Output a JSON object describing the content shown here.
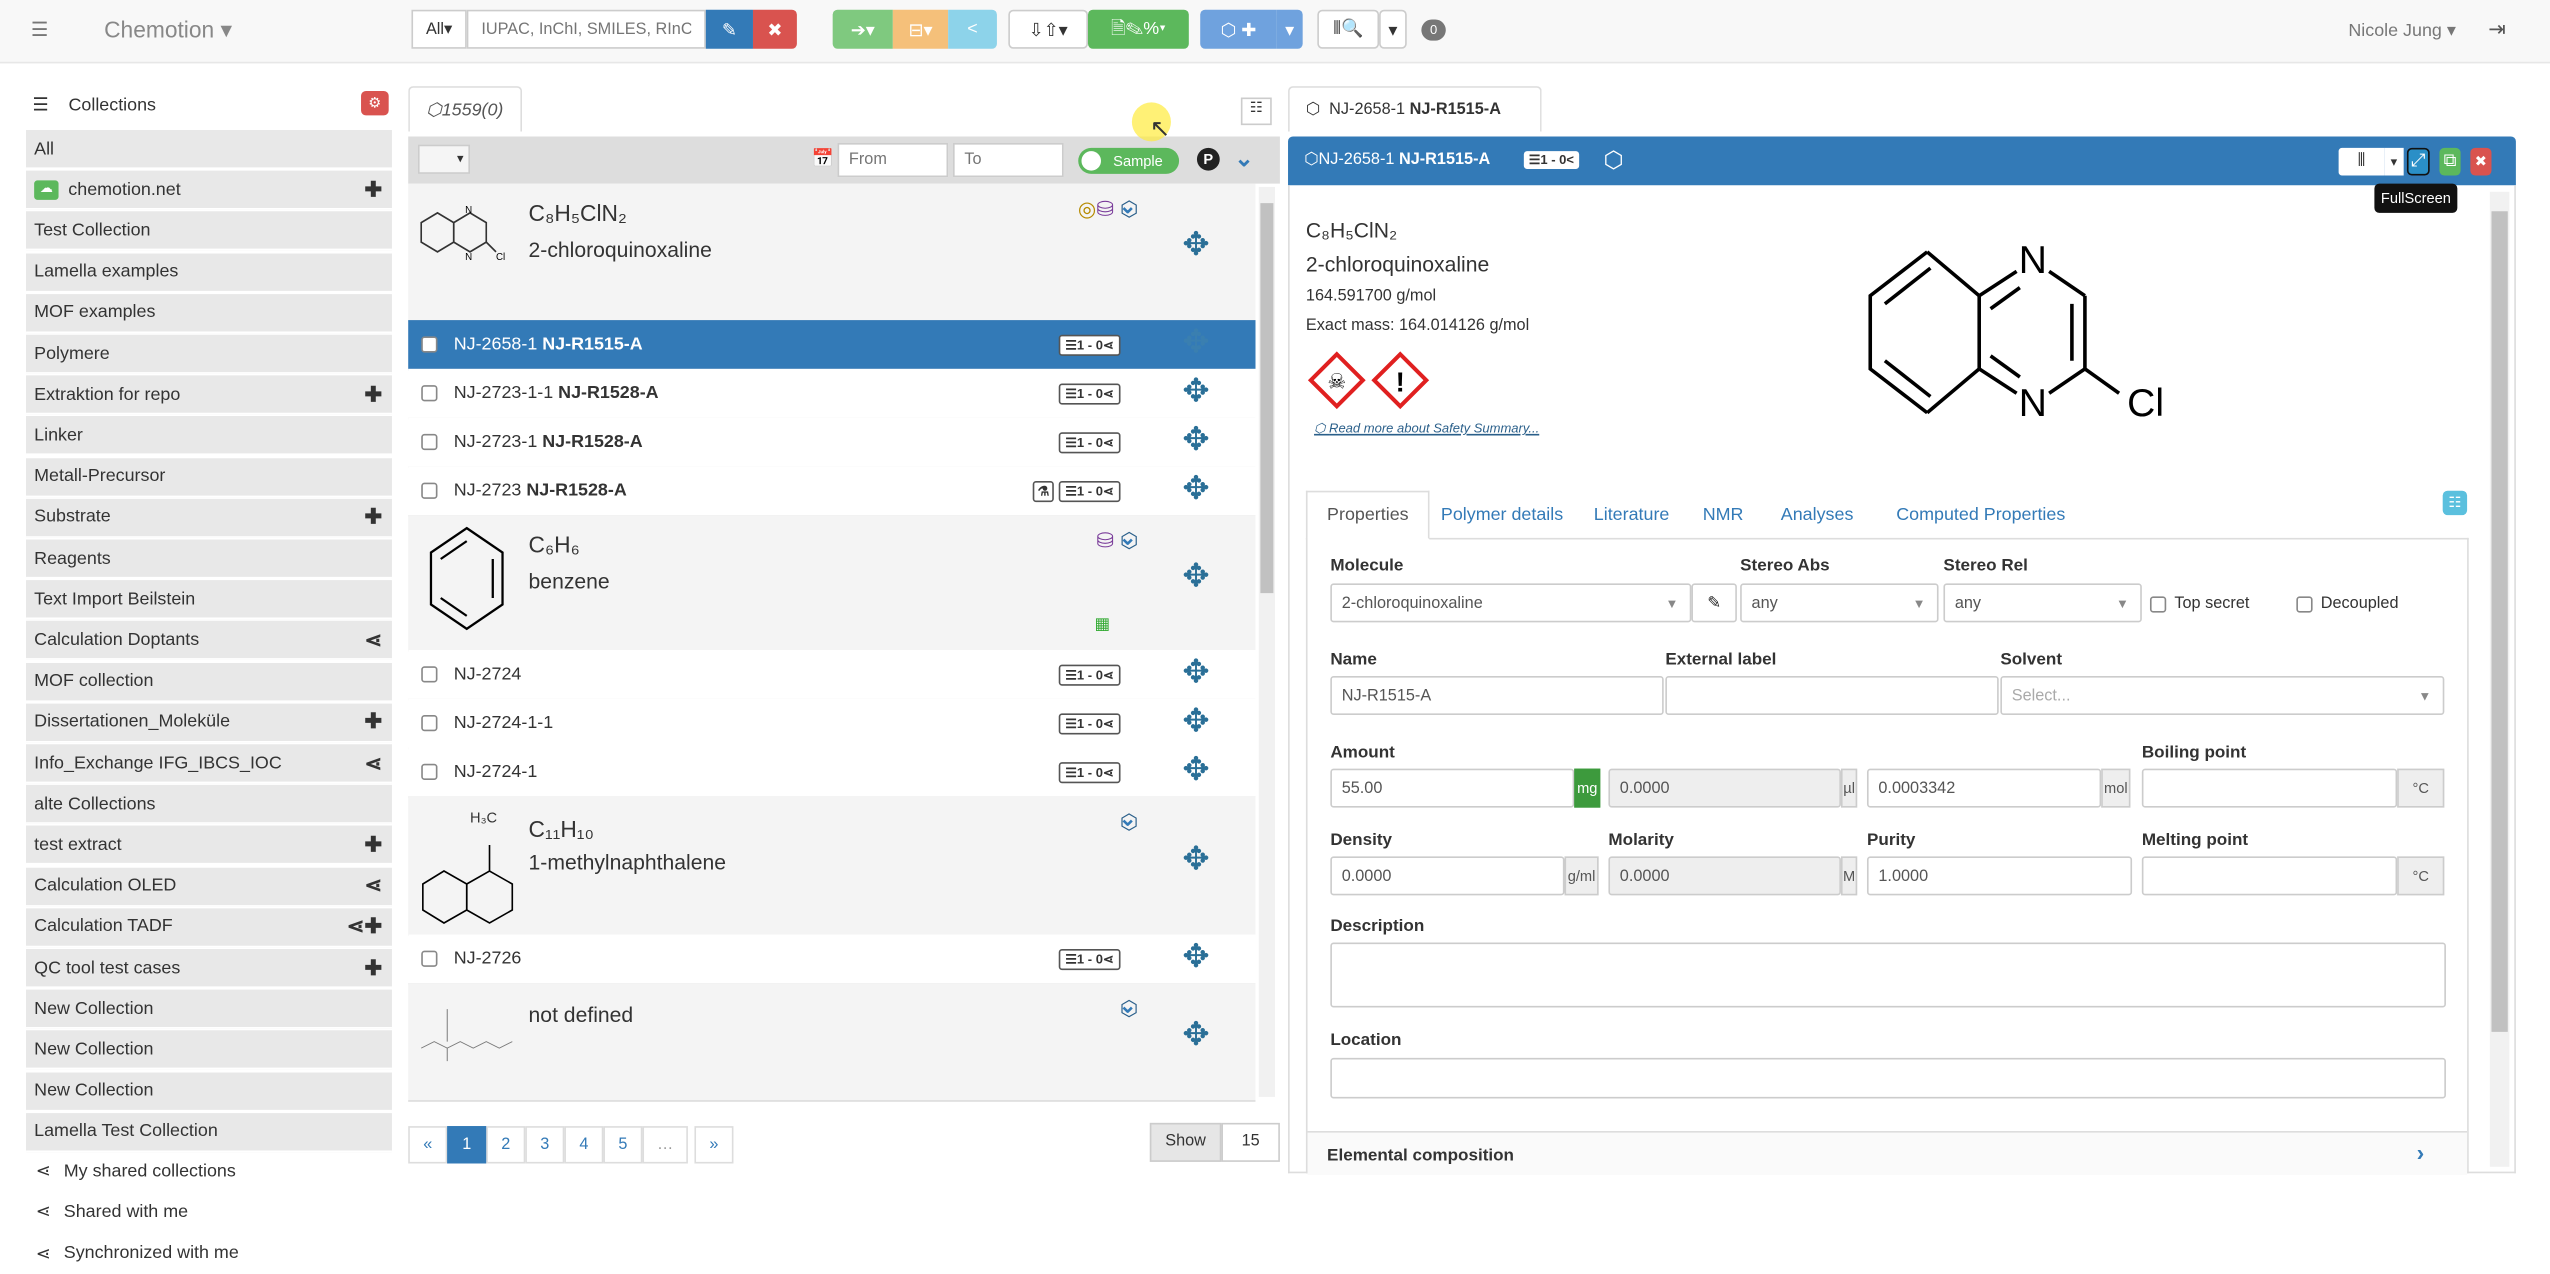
{
  "navbar": {
    "brand": "Chemotion",
    "search_scope": "All",
    "search_placeholder": "IUPAC, InChI, SMILES, RInChI...",
    "notification_count": "0",
    "user": "Nicole Jung"
  },
  "sidebar": {
    "title": "Collections",
    "items": [
      {
        "label": "All",
        "action": ""
      },
      {
        "label": "chemotion.net",
        "action": "+"
      },
      {
        "label": "Test Collection",
        "action": ""
      },
      {
        "label": "Lamella examples",
        "action": ""
      },
      {
        "label": "MOF examples",
        "action": ""
      },
      {
        "label": "Polymere",
        "action": ""
      },
      {
        "label": "Extraktion for repo",
        "action": "+"
      },
      {
        "label": "Linker",
        "action": ""
      },
      {
        "label": "Metall-Precursor",
        "action": ""
      },
      {
        "label": "Substrate",
        "action": "+"
      },
      {
        "label": "Reagents",
        "action": ""
      },
      {
        "label": "Text Import Beilstein",
        "action": ""
      },
      {
        "label": "Calculation Doptants",
        "action": "share"
      },
      {
        "label": "MOF collection",
        "action": ""
      },
      {
        "label": "Dissertationen_Moleküle",
        "action": "+"
      },
      {
        "label": "Info_Exchange IFG_IBCS_IOC",
        "action": "share"
      },
      {
        "label": "alte Collections",
        "action": ""
      },
      {
        "label": "test extract",
        "action": "+"
      },
      {
        "label": "Calculation OLED",
        "action": "share"
      },
      {
        "label": "Calculation TADF",
        "action": "share+"
      },
      {
        "label": "QC tool test cases",
        "action": "+"
      },
      {
        "label": "New Collection",
        "action": ""
      },
      {
        "label": "New Collection",
        "action": ""
      },
      {
        "label": "New Collection",
        "action": ""
      },
      {
        "label": "Lamella Test Collection",
        "action": ""
      }
    ],
    "shared": [
      "My shared collections",
      "Shared with me",
      "Synchronized with me"
    ]
  },
  "list": {
    "tab_label": "1559(0)",
    "from_placeholder": "From",
    "to_placeholder": "To",
    "toggle_label": "Sample",
    "p_label": "P",
    "groups": [
      {
        "formula": "C₈H₅ClN₂",
        "name": "2-chloroquinoxaline",
        "samples": [
          {
            "id": "NJ-2658-1",
            "label": "NJ-R1515-A",
            "badge": "1 - 0",
            "selected": true
          },
          {
            "id": "NJ-2723-1-1",
            "label": "NJ-R1528-A",
            "badge": "1 - 0"
          },
          {
            "id": "NJ-2723-1",
            "label": "NJ-R1528-A",
            "badge": "1 - 0"
          },
          {
            "id": "NJ-2723",
            "label": "NJ-R1528-A",
            "badge": "1 - 0"
          }
        ]
      },
      {
        "formula": "C₆H₆",
        "name": "benzene",
        "samples": [
          {
            "id": "NJ-2724",
            "label": "",
            "badge": "1 - 0"
          },
          {
            "id": "NJ-2724-1-1",
            "label": "",
            "badge": "1 - 0"
          },
          {
            "id": "NJ-2724-1",
            "label": "",
            "badge": "1 - 0"
          }
        ]
      },
      {
        "formula": "C₁₁H₁₀",
        "name": "1-methylnaphthalene",
        "structure_label": "H₃C",
        "samples": [
          {
            "id": "NJ-2726",
            "label": "",
            "badge": "1 - 0"
          }
        ]
      },
      {
        "formula": "",
        "name": "not defined",
        "samples": []
      }
    ],
    "pagination": {
      "prev": "«",
      "pages": [
        "1",
        "2",
        "3",
        "4",
        "5",
        "…"
      ],
      "next": "»",
      "current": "1",
      "show_label": "Show",
      "show_value": "15"
    }
  },
  "detail": {
    "tab_label": "NJ-2658-1",
    "tab_label_bold": "NJ-R1515-A",
    "header_id": "NJ-2658-1",
    "header_name": "NJ-R1515-A",
    "header_badge": "1 - 0",
    "tooltip": "FullScreen",
    "formula": "C₈H₅ClN₂",
    "name": "2-chloroquinoxaline",
    "mw": "164.591700 g/mol",
    "exact_mass": "Exact mass: 164.014126 g/mol",
    "safety_link": "Read more about Safety Summary...",
    "structure_atoms": {
      "n1": "N",
      "n2": "N",
      "cl": "Cl"
    },
    "tabs": [
      "Properties",
      "Polymer details",
      "Literature",
      "NMR",
      "Analyses",
      "Computed Properties"
    ],
    "active_tab": "Properties",
    "form": {
      "molecule_label": "Molecule",
      "molecule_value": "2-chloroquinoxaline",
      "stereo_abs_label": "Stereo Abs",
      "stereo_abs_value": "any",
      "stereo_rel_label": "Stereo Rel",
      "stereo_rel_value": "any",
      "top_secret": "Top secret",
      "decoupled": "Decoupled",
      "name_label": "Name",
      "name_value": "NJ-R1515-A",
      "external_label": "External label",
      "external_value": "",
      "solvent_label": "Solvent",
      "solvent_placeholder": "Select...",
      "amount_label": "Amount",
      "amount_mg": "55.00",
      "unit_mg": "mg",
      "amount_ul": "0.0000",
      "unit_ul": "µl",
      "amount_mol": "0.0003342",
      "unit_mol": "mol",
      "boiling_label": "Boiling point",
      "unit_c": "°C",
      "density_label": "Density",
      "density_value": "0.0000",
      "unit_density": "g/ml",
      "molarity_label": "Molarity",
      "molarity_value": "0.0000",
      "unit_molarity": "M",
      "purity_label": "Purity",
      "purity_value": "1.0000",
      "melting_label": "Melting point",
      "description_label": "Description",
      "location_label": "Location",
      "elemental": "Elemental composition"
    }
  },
  "colors": {
    "primary": "#337ab7",
    "success": "#5cb85c",
    "danger": "#d9534f",
    "warning": "#f0ad4e",
    "info": "#5bc0de"
  }
}
